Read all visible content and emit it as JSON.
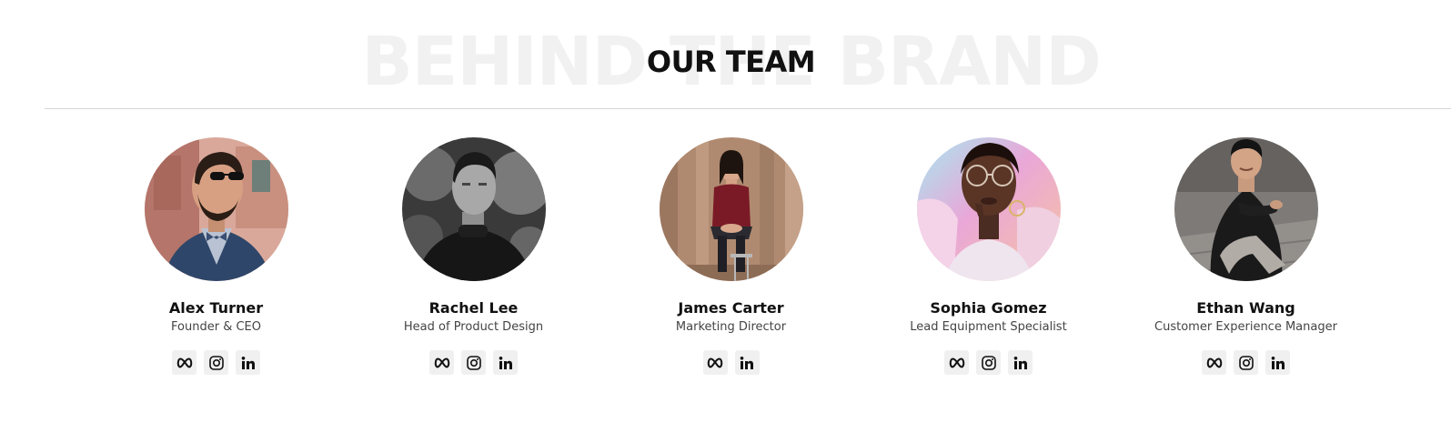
{
  "section": {
    "background_text": "BEHIND THE BRAND",
    "title": "OUR TEAM"
  },
  "members": [
    {
      "name": "Alex Turner",
      "role": "Founder & CEO",
      "socials": [
        "meta-icon",
        "instagram-icon",
        "linkedin-icon"
      ]
    },
    {
      "name": "Rachel Lee",
      "role": "Head of Product Design",
      "socials": [
        "meta-icon",
        "instagram-icon",
        "linkedin-icon"
      ]
    },
    {
      "name": "James Carter",
      "role": "Marketing Director",
      "socials": [
        "meta-icon",
        "linkedin-icon"
      ]
    },
    {
      "name": "Sophia Gomez",
      "role": "Lead Equipment Specialist",
      "socials": [
        "meta-icon",
        "instagram-icon",
        "linkedin-icon"
      ]
    },
    {
      "name": "Ethan Wang",
      "role": "Customer Experience Manager",
      "socials": [
        "meta-icon",
        "instagram-icon",
        "linkedin-icon"
      ]
    }
  ],
  "colors": {
    "title": "#111111",
    "background_text": "#f1f1f1",
    "divider": "#d6d6d6",
    "social_button_bg": "#f0f0f0"
  }
}
